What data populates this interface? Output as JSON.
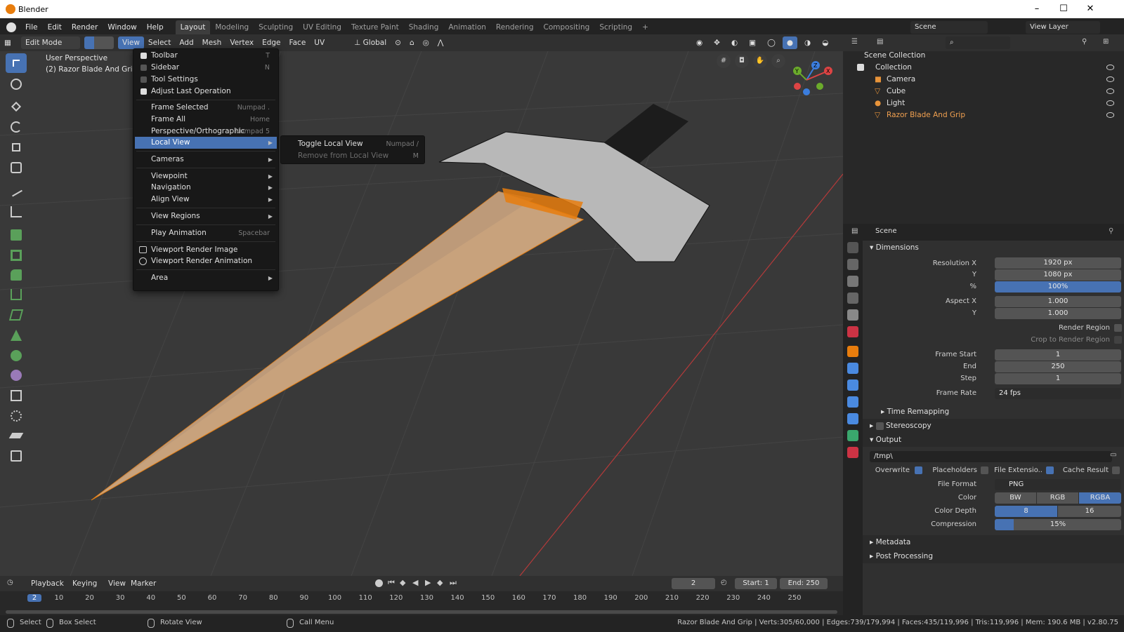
{
  "window": {
    "title": "Blender",
    "minimize": "–",
    "maximize": "☐",
    "close": "✕"
  },
  "menubar": {
    "items": [
      "File",
      "Edit",
      "Render",
      "Window",
      "Help"
    ],
    "workspaces": [
      "Layout",
      "Modeling",
      "Sculpting",
      "UV Editing",
      "Texture Paint",
      "Shading",
      "Animation",
      "Rendering",
      "Compositing",
      "Scripting"
    ],
    "add_tab": "+",
    "scene": "Scene",
    "view_layer": "View Layer"
  },
  "viewport_header": {
    "mode": "Edit Mode",
    "menus": [
      "View",
      "Select",
      "Add",
      "Mesh",
      "Vertex",
      "Edge",
      "Face",
      "UV"
    ],
    "orientation": "Global"
  },
  "viewport": {
    "perspective": "User Perspective",
    "object_info": "(2) Razor Blade And Grip",
    "gizmo_axes": [
      "Z",
      "Y",
      "X"
    ]
  },
  "view_menu": {
    "items": [
      {
        "label": "Toolbar",
        "shortcut": "T",
        "check": true
      },
      {
        "label": "Sidebar",
        "shortcut": "N",
        "check": false
      },
      {
        "label": "Tool Settings",
        "shortcut": "",
        "check": false
      },
      {
        "label": "Adjust Last Operation",
        "shortcut": "",
        "check": true
      },
      {
        "label": "Frame Selected",
        "shortcut": "Numpad ."
      },
      {
        "label": "Frame All",
        "shortcut": "Home"
      },
      {
        "label": "Perspective/Orthographic",
        "shortcut": "Numpad 5"
      },
      {
        "label": "Local View",
        "shortcut": ""
      },
      {
        "label": "Cameras",
        "shortcut": ""
      },
      {
        "label": "Viewpoint",
        "shortcut": ""
      },
      {
        "label": "Navigation",
        "shortcut": ""
      },
      {
        "label": "Align View",
        "shortcut": ""
      },
      {
        "label": "View Regions",
        "shortcut": ""
      },
      {
        "label": "Play Animation",
        "shortcut": "Spacebar"
      },
      {
        "label": "Viewport Render Image",
        "shortcut": ""
      },
      {
        "label": "Viewport Render Animation",
        "shortcut": ""
      },
      {
        "label": "Area",
        "shortcut": ""
      }
    ]
  },
  "local_view_submenu": {
    "items": [
      {
        "label": "Toggle Local View",
        "shortcut": "Numpad /"
      },
      {
        "label": "Remove from Local View",
        "shortcut": "M"
      }
    ]
  },
  "outliner": {
    "root": "Scene Collection",
    "collection": "Collection",
    "objects": [
      "Camera",
      "Cube",
      "Light",
      "Razor Blade And Grip"
    ]
  },
  "properties": {
    "header": "Scene",
    "dimensions": {
      "title": "Dimensions",
      "res_x_label": "Resolution X",
      "res_x": "1920 px",
      "res_y_label": "Y",
      "res_y": "1080 px",
      "pct_label": "%",
      "pct": "100%",
      "aspect_x_label": "Aspect X",
      "aspect_x": "1.000",
      "aspect_y_label": "Y",
      "aspect_y": "1.000",
      "render_region": "Render Region",
      "crop": "Crop to Render Region",
      "frame_start_label": "Frame Start",
      "frame_start": "1",
      "end_label": "End",
      "end": "250",
      "step_label": "Step",
      "step": "1",
      "frame_rate_label": "Frame Rate",
      "frame_rate": "24 fps",
      "time_remap": "Time Remapping"
    },
    "stereoscopy": "Stereoscopy",
    "output": {
      "title": "Output",
      "path": "/tmp\\",
      "overwrite": "Overwrite",
      "placeholders": "Placeholders",
      "file_ext": "File Extensio..",
      "cache": "Cache Result",
      "format_label": "File Format",
      "format": "PNG",
      "color_label": "Color",
      "colors": [
        "BW",
        "RGB",
        "RGBA"
      ],
      "depth_label": "Color Depth",
      "depths": [
        "8",
        "16"
      ],
      "compression_label": "Compression",
      "compression": "15%",
      "compression_fraction": 0.15
    },
    "metadata": "Metadata",
    "post": "Post Processing"
  },
  "timeline": {
    "menus": [
      "Playback",
      "Keying",
      "View",
      "Marker"
    ],
    "current_frame": "2",
    "start_label": "Start:",
    "start": "1",
    "end_label": "End:",
    "end": "250",
    "ticks": [
      "2",
      "10",
      "20",
      "30",
      "40",
      "50",
      "60",
      "70",
      "80",
      "90",
      "100",
      "110",
      "120",
      "130",
      "140",
      "150",
      "160",
      "170",
      "180",
      "190",
      "200",
      "210",
      "220",
      "230",
      "240",
      "250"
    ]
  },
  "statusbar": {
    "select": "Select",
    "box_select": "Box Select",
    "rotate": "Rotate View",
    "call_menu": "Call Menu",
    "stats": "Razor Blade And Grip | Verts:305/60,000 | Edges:739/179,994 | Faces:435/119,996 | Tris:119,996 | Mem: 190.6 MB | v2.80.75"
  },
  "colors": {
    "accent": "#4772b3",
    "orange": "#e87d0d",
    "bg": "#393939"
  }
}
